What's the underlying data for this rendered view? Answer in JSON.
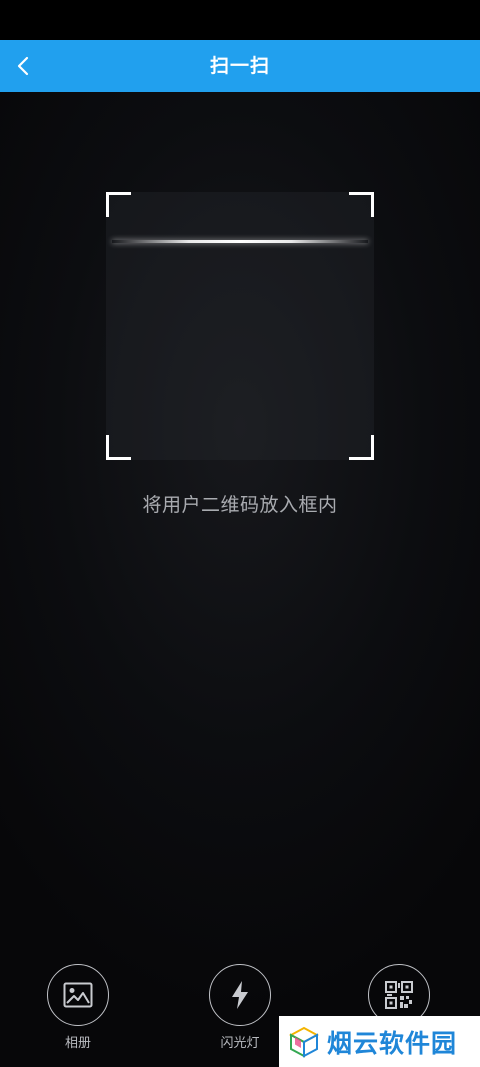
{
  "nav": {
    "title": "扫一扫",
    "back_icon": "chevron-left-icon",
    "color": "#21a0ee"
  },
  "scanner": {
    "hint": "将用户二维码放入框内"
  },
  "tools": {
    "album": {
      "label": "相册",
      "icon": "image-icon"
    },
    "flash": {
      "label": "闪光灯",
      "icon": "lightning-icon"
    },
    "my_code": {
      "label": "",
      "icon": "qr-code-icon"
    }
  },
  "watermark": {
    "text": "烟云软件园",
    "color": "#1f86d8"
  }
}
